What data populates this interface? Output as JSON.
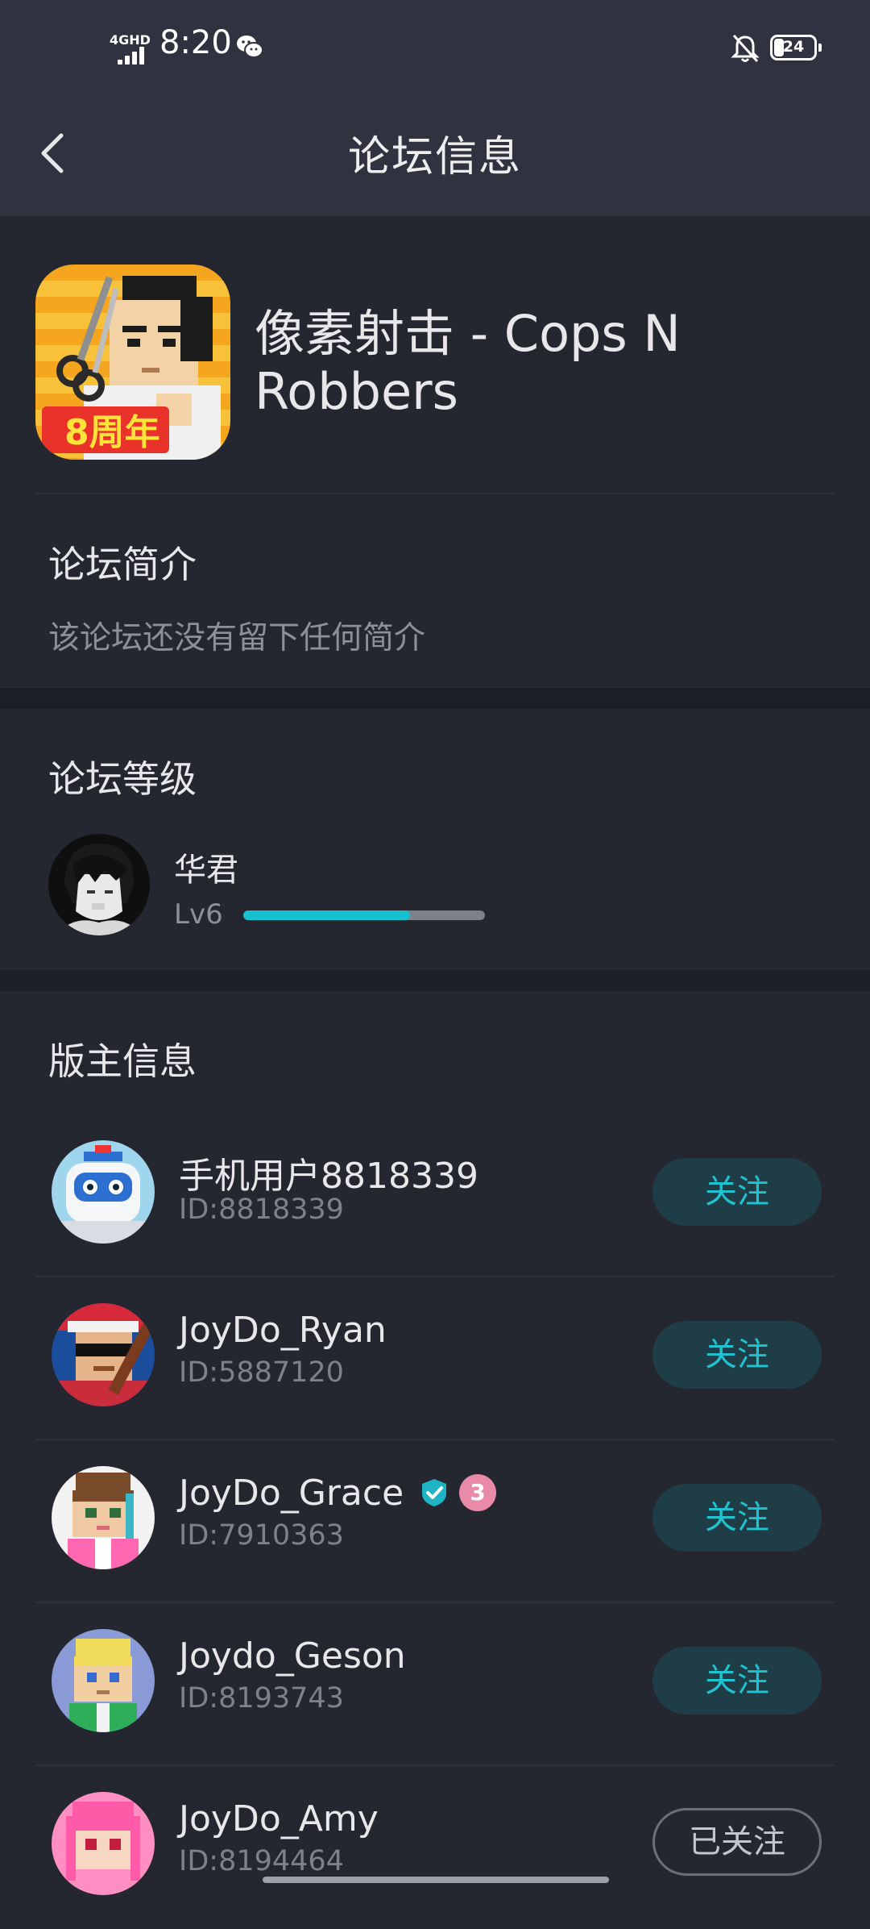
{
  "status_bar": {
    "network": "4GHD",
    "time": "8:20",
    "battery": "24"
  },
  "header": {
    "title": "论坛信息"
  },
  "forum": {
    "name": "像素射击 - Cops N Robbers",
    "icon_badge_text": "8周年"
  },
  "intro": {
    "title": "论坛简介",
    "text": "该论坛还没有留下任何简介"
  },
  "level": {
    "title": "论坛等级",
    "user_name": "华君",
    "level_label": "Lv6",
    "progress_fraction": 0.69
  },
  "moderators": {
    "title": "版主信息",
    "items": [
      {
        "name": "手机用户8818339",
        "id": "ID:8818339",
        "button": "关注",
        "followed": false
      },
      {
        "name": "JoyDo_Ryan",
        "id": "ID:5887120",
        "button": "关注",
        "followed": false
      },
      {
        "name": "JoyDo_Grace",
        "id": "ID:7910363",
        "button": "关注",
        "followed": false,
        "badge_number": "3"
      },
      {
        "name": "Joydo_Geson",
        "id": "ID:8193743",
        "button": "关注",
        "followed": false
      },
      {
        "name": "JoyDo_Amy",
        "id": "ID:8194464",
        "button": "已关注",
        "followed": true
      }
    ]
  },
  "colors": {
    "accent": "#17c0cf",
    "background": "#252730",
    "header": "#30333f"
  }
}
